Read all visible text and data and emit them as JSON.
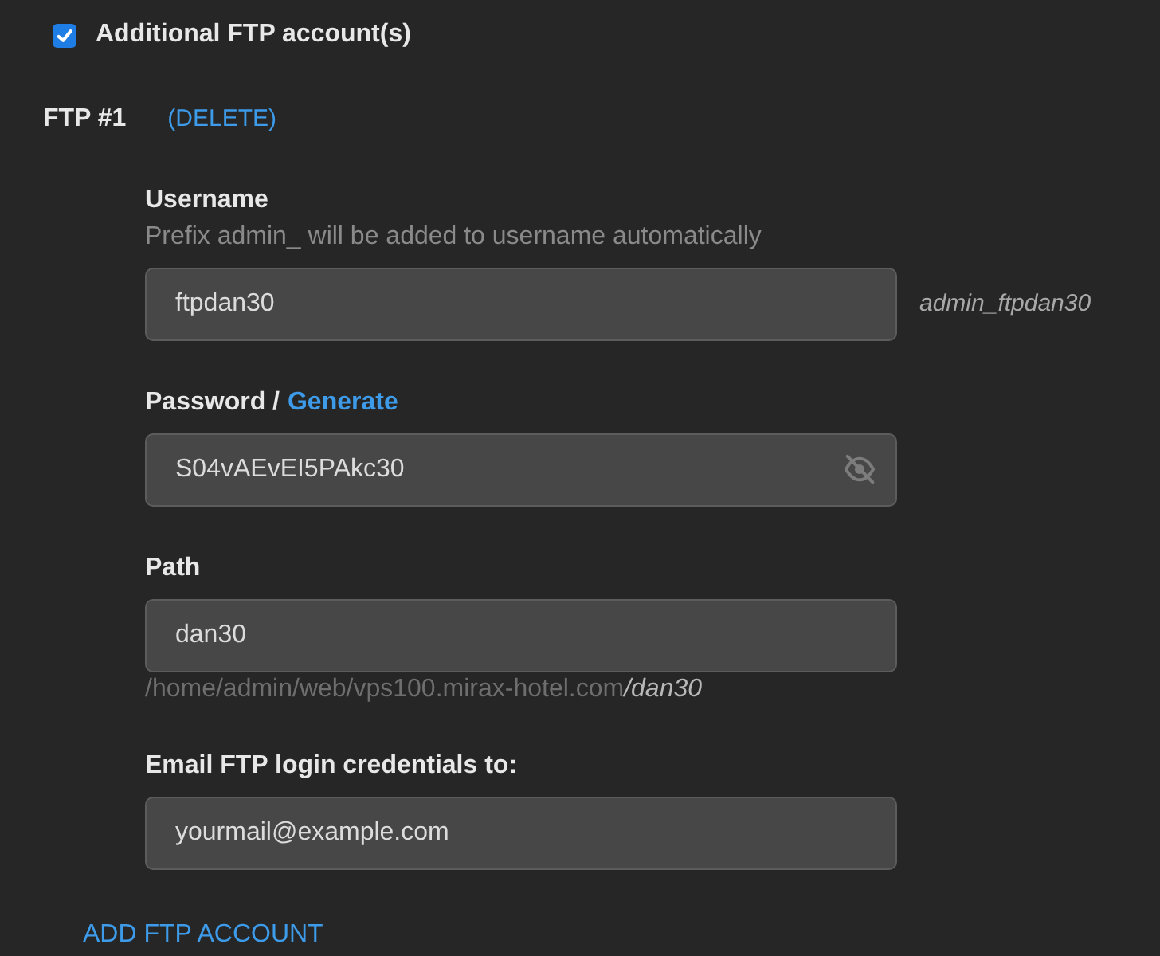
{
  "enable": {
    "label": "Additional FTP account(s)",
    "checked": true
  },
  "accounts": [
    {
      "title": "FTP #1",
      "delete_link": "(DELETE)",
      "fields": [
        {
          "kind": "username",
          "label": "Username",
          "hint": "Prefix admin_ will be added to username automatically",
          "value": "ftpdan30",
          "note": "admin_ftpdan30"
        },
        {
          "kind": "password",
          "label": "Password /",
          "link": "Generate",
          "value": "S04vAEvEI5PAkc30"
        },
        {
          "kind": "path",
          "label": "Path",
          "value": "dan30",
          "path_base": "/home/admin/web/vps100.mirax-hotel.com",
          "path_tail": "/dan30"
        },
        {
          "kind": "email",
          "label": "Email FTP login credentials to:",
          "value": "yourmail@example.com"
        }
      ]
    }
  ],
  "add_link": "ADD FTP ACCOUNT"
}
